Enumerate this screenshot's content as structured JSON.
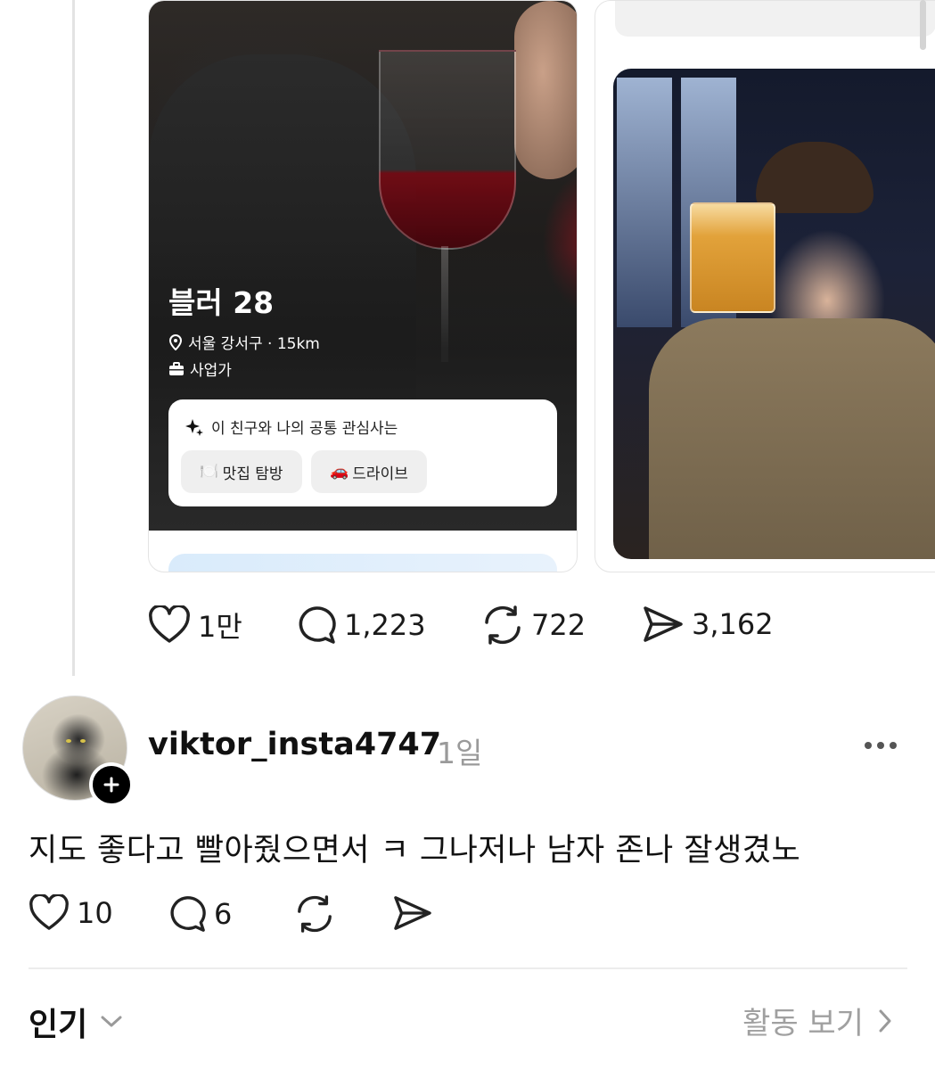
{
  "card1": {
    "name_age": "블러 28",
    "location": "서울 강서구 · 15km",
    "job": "사업가",
    "interest_header": "이 친구와 나의 공통 관심사는",
    "interests": [
      {
        "emoji": "🍽️",
        "label": "맛집 탐방"
      },
      {
        "emoji": "🚗",
        "label": "드라이브"
      }
    ]
  },
  "post_stats": {
    "likes": "1만",
    "comments": "1,223",
    "reposts": "722",
    "shares": "3,162"
  },
  "reply": {
    "username": "viktor_insta4747",
    "time": "1일",
    "text": "지도 좋다고 빨아줬으면서 ㅋ 그나저나 남자 존나 잘생겼노",
    "likes": "10",
    "comments": "6"
  },
  "footer": {
    "popular_label": "인기",
    "activity_label": "활동 보기"
  },
  "icons": {
    "like": "heart-icon",
    "comment": "comment-bubble-icon",
    "repost": "repost-icon",
    "share": "send-icon",
    "more": "more-dots-icon"
  }
}
